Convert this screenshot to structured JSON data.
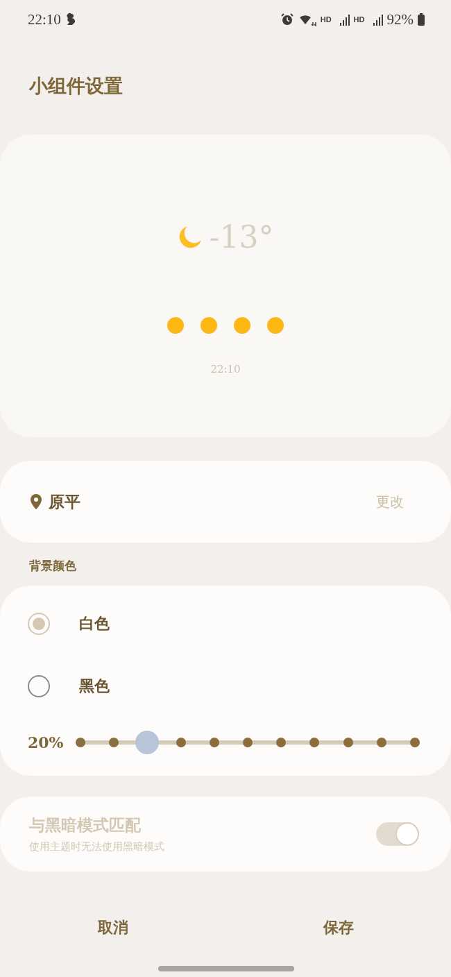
{
  "status_bar": {
    "time": "22:10",
    "battery": "92%",
    "network_labels": [
      "HD",
      "HD"
    ]
  },
  "title": "小组件设置",
  "preview": {
    "temperature": "-13°",
    "forecast_dots": [
      {
        "color": "#fbb713"
      },
      {
        "color": "#fbb713"
      },
      {
        "color": "#fbb713"
      },
      {
        "color": "#fbb713"
      }
    ],
    "updated_time": "22:10"
  },
  "location": {
    "name": "原平",
    "action": "更改"
  },
  "background": {
    "label": "背景颜色",
    "options": [
      {
        "label": "白色",
        "selected": true
      },
      {
        "label": "黑色",
        "selected": false
      }
    ],
    "transparency": {
      "reading": "20%",
      "level": 0.2
    }
  },
  "dark_mode": {
    "title": "与黑暗模式匹配",
    "subtitle": "使用主题时无法使用黑暗模式",
    "on": true,
    "disabled": true
  },
  "buttons": [
    "取消",
    "保存"
  ]
}
